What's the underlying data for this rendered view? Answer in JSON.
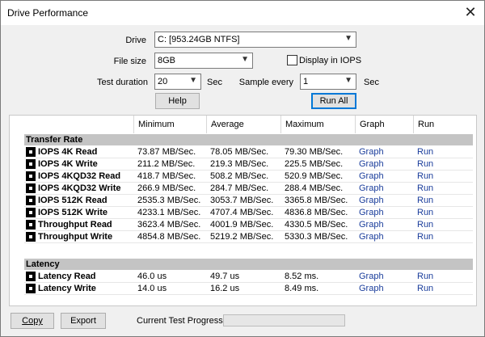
{
  "window": {
    "title": "Drive Performance",
    "close_glyph": "✕"
  },
  "form": {
    "drive_label": "Drive",
    "drive_value": "C: [953.24GB NTFS]",
    "file_size_label": "File size",
    "file_size_value": "8GB",
    "display_iops_label": "Display in IOPS",
    "test_duration_label": "Test duration",
    "test_duration_value": "20",
    "test_duration_unit": "Sec",
    "sample_every_label": "Sample every",
    "sample_every_value": "1",
    "sample_every_unit": "Sec",
    "help_label": "Help",
    "run_all_label": "Run All"
  },
  "table": {
    "headers": [
      "Minimum",
      "Average",
      "Maximum",
      "Graph",
      "Run"
    ],
    "sections": [
      {
        "title": "Transfer Rate",
        "rows": [
          {
            "name": "IOPS 4K Read",
            "min": "73.87 MB/Sec.",
            "avg": "78.05 MB/Sec.",
            "max": "79.30 MB/Sec.",
            "graph": "Graph",
            "run": "Run"
          },
          {
            "name": "IOPS 4K Write",
            "min": "211.2 MB/Sec.",
            "avg": "219.3 MB/Sec.",
            "max": "225.5 MB/Sec.",
            "graph": "Graph",
            "run": "Run"
          },
          {
            "name": "IOPS 4KQD32 Read",
            "min": "418.7 MB/Sec.",
            "avg": "508.2 MB/Sec.",
            "max": "520.9 MB/Sec.",
            "graph": "Graph",
            "run": "Run"
          },
          {
            "name": "IOPS 4KQD32 Write",
            "min": "266.9 MB/Sec.",
            "avg": "284.7 MB/Sec.",
            "max": "288.4 MB/Sec.",
            "graph": "Graph",
            "run": "Run"
          },
          {
            "name": "IOPS 512K Read",
            "min": "2535.3 MB/Sec.",
            "avg": "3053.7 MB/Sec.",
            "max": "3365.8 MB/Sec.",
            "graph": "Graph",
            "run": "Run"
          },
          {
            "name": "IOPS 512K Write",
            "min": "4233.1 MB/Sec.",
            "avg": "4707.4 MB/Sec.",
            "max": "4836.8 MB/Sec.",
            "graph": "Graph",
            "run": "Run"
          },
          {
            "name": "Throughput Read",
            "min": "3623.4 MB/Sec.",
            "avg": "4001.9 MB/Sec.",
            "max": "4330.5 MB/Sec.",
            "graph": "Graph",
            "run": "Run"
          },
          {
            "name": "Throughput Write",
            "min": "4854.8 MB/Sec.",
            "avg": "5219.2 MB/Sec.",
            "max": "5330.3 MB/Sec.",
            "graph": "Graph",
            "run": "Run"
          }
        ]
      },
      {
        "title": "Latency",
        "rows": [
          {
            "name": "Latency Read",
            "min": "46.0 us",
            "avg": "49.7 us",
            "max": "8.52 ms.",
            "graph": "Graph",
            "run": "Run"
          },
          {
            "name": "Latency Write",
            "min": "14.0 us",
            "avg": "16.2 us",
            "max": "8.49 ms.",
            "graph": "Graph",
            "run": "Run"
          }
        ]
      }
    ]
  },
  "footer": {
    "copy_label": "Copy",
    "export_label": "Export",
    "progress_label": "Current Test Progress",
    "progress_fraction": 0
  },
  "colors": {
    "link": "#1a3d9b",
    "section_bg": "#c4c4c4",
    "default_button_border": "#0078d7"
  }
}
